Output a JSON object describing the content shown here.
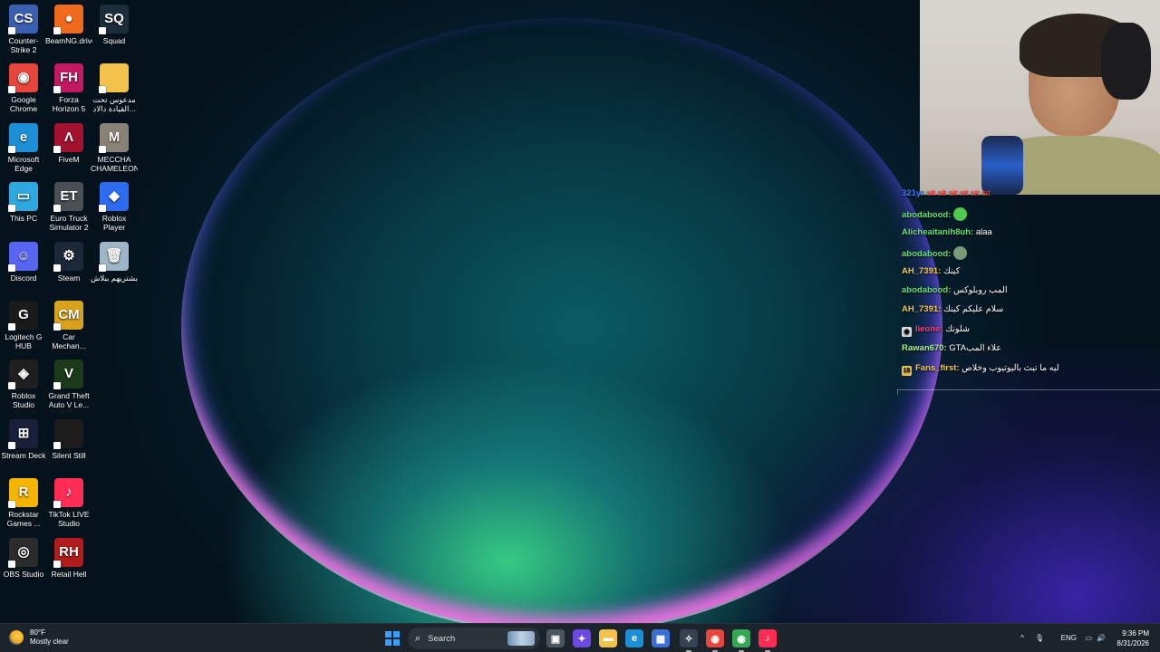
{
  "desktop": {
    "icons": [
      {
        "label": "Counter-Strike 2",
        "icon": "cs2-icon",
        "color": "#3a5fb0",
        "glyph": "CS"
      },
      {
        "label": "BeamNG.drive",
        "icon": "beamng-icon",
        "color": "#f06a1e",
        "glyph": "●"
      },
      {
        "label": "Squad",
        "icon": "squad-icon",
        "color": "#1d2d3a",
        "glyph": "SQ"
      },
      {
        "label": "Google Chrome",
        "icon": "chrome-icon",
        "color": "#e8453c",
        "glyph": "◉"
      },
      {
        "label": "Forza Horizon 5",
        "icon": "forza-icon",
        "color": "#c21a62",
        "glyph": "FH"
      },
      {
        "label": "مدعوس تحت القيادة دالاد...",
        "icon": "folder-icon",
        "color": "#f3c24a",
        "glyph": ""
      },
      {
        "label": "Microsoft Edge",
        "icon": "edge-icon",
        "color": "#1c8fd6",
        "glyph": "e"
      },
      {
        "label": "FiveM",
        "icon": "fivem-icon",
        "color": "#a3122f",
        "glyph": "Λ"
      },
      {
        "label": "MECCHA CHAMELEON",
        "icon": "meccha-icon",
        "color": "#8a8276",
        "glyph": "M"
      },
      {
        "label": "This PC",
        "icon": "monitor-icon",
        "color": "#2fa8e0",
        "glyph": "▭"
      },
      {
        "label": "Euro Truck Simulator 2",
        "icon": "ets2-icon",
        "color": "#4a4f56",
        "glyph": "ET"
      },
      {
        "label": "Roblox Player",
        "icon": "roblox-icon",
        "color": "#2d6cf0",
        "glyph": "◆"
      },
      {
        "label": "Discord",
        "icon": "discord-icon",
        "color": "#5865f2",
        "glyph": "☺"
      },
      {
        "label": "Steam",
        "icon": "steam-icon",
        "color": "#1b2838",
        "glyph": "⚙"
      },
      {
        "label": "بشتريهم ببلاش",
        "icon": "recycle-bin-icon",
        "color": "#9fb6c6",
        "glyph": "🗑"
      },
      {
        "label": "Logitech G HUB",
        "icon": "logitech-icon",
        "color": "#1a1a1a",
        "glyph": "G"
      },
      {
        "label": "Car Mechan...",
        "icon": "car-mechanic-icon",
        "color": "#d8a21c",
        "glyph": "CM"
      },
      {
        "label": "Roblox Studio",
        "icon": "roblox-studio-icon",
        "color": "#1f1f1f",
        "glyph": "◈"
      },
      {
        "label": "Grand Theft Auto V Le...",
        "icon": "gta-icon",
        "color": "#1a3a1a",
        "glyph": "V"
      },
      {
        "label": "Stream Deck",
        "icon": "stream-deck-icon",
        "color": "#1a1f3a",
        "glyph": "⊞"
      },
      {
        "label": "Silent Still",
        "icon": "silent-still-icon",
        "color": "#1c1c1c",
        "glyph": ""
      },
      {
        "label": "Rockstar Games ...",
        "icon": "rockstar-icon",
        "color": "#f4b400",
        "glyph": "R"
      },
      {
        "label": "TikTok LIVE Studio",
        "icon": "tiktok-icon",
        "color": "#fe2c55",
        "glyph": "♪"
      },
      {
        "label": "OBS Studio",
        "icon": "obs-icon",
        "color": "#2c2c2c",
        "glyph": "◎"
      },
      {
        "label": "Retail Hell",
        "icon": "retail-hell-icon",
        "color": "#b01c1c",
        "glyph": "RH"
      }
    ]
  },
  "chat": {
    "messages": [
      {
        "user": "321yr",
        "user_color": "#2f7fff",
        "text": "sit sit sit sit sit sit",
        "text_color": "#ff4040",
        "badge": "",
        "emote": ""
      },
      {
        "user": "abodabood:",
        "user_color": "#63e26f",
        "text": "",
        "text_color": "#ffffff",
        "badge": "",
        "emote": "#4ecb4e"
      },
      {
        "user": "Alicheaitanih8uh:",
        "user_color": "#63e26f",
        "text": "alaa",
        "text_color": "#ffffff",
        "badge": "",
        "emote": ""
      },
      {
        "user": "abodabood:",
        "user_color": "#63e26f",
        "text": "",
        "text_color": "#ffffff",
        "badge": "",
        "emote": "#7a9a7a"
      },
      {
        "user": "AH_7391:",
        "user_color": "#f2c94c",
        "text": "كينك",
        "text_color": "#ffffff",
        "badge": "",
        "emote": ""
      },
      {
        "user": "abodabood:",
        "user_color": "#63e26f",
        "text": "المب روبلوكس",
        "text_color": "#ffffff",
        "badge": "",
        "emote": ""
      },
      {
        "user": "AH_7391:",
        "user_color": "#f2c94c",
        "text": "سلام عليكم كينك",
        "text_color": "#ffffff",
        "badge": "",
        "emote": ""
      },
      {
        "user": "lieone:",
        "user_color": "#ff3c7a",
        "text": "شلونك",
        "text_color": "#ffffff",
        "badge": "◉",
        "emote": ""
      },
      {
        "user": "Rawan670:",
        "user_color": "#a8f08a",
        "text": "GTAعلاء المب",
        "text_color": "#ffffff",
        "badge": "",
        "emote": ""
      },
      {
        "user": "Fans_first:",
        "user_color": "#f2c94c",
        "text": "ليه ما تبث باليوتيوب وخلاص",
        "text_color": "#ffffff",
        "badge": "15",
        "emote": ""
      }
    ]
  },
  "taskbar": {
    "weather": {
      "temp": "80°F",
      "condition": "Mostly clear"
    },
    "search_label": "Search",
    "apps": [
      {
        "name": "task-view-icon",
        "glyph": "▣",
        "color": "#4a5560"
      },
      {
        "name": "copilot-icon",
        "glyph": "✦",
        "color": "#6a4ae0"
      },
      {
        "name": "file-explorer-icon",
        "glyph": "▬",
        "color": "#f3c24a"
      },
      {
        "name": "edge-taskbar-icon",
        "glyph": "e",
        "color": "#1c8fd6"
      },
      {
        "name": "store-icon",
        "glyph": "▦",
        "color": "#3a6fd8"
      },
      {
        "name": "cs2-taskbar-icon",
        "glyph": "✧",
        "color": "#364252"
      },
      {
        "name": "chrome-taskbar-icon",
        "glyph": "◉",
        "color": "#e8453c"
      },
      {
        "name": "chrome-profile-taskbar-icon",
        "glyph": "◉",
        "color": "#34a853"
      },
      {
        "name": "tiktok-taskbar-icon",
        "glyph": "♪",
        "color": "#fe2c55"
      }
    ],
    "tray": {
      "chevron": "^",
      "mic": "🎙",
      "language": "ENG",
      "network": "▭",
      "volume": "🔊"
    },
    "clock": {
      "time": "9:36 PM",
      "date": "8/31/2026"
    }
  }
}
